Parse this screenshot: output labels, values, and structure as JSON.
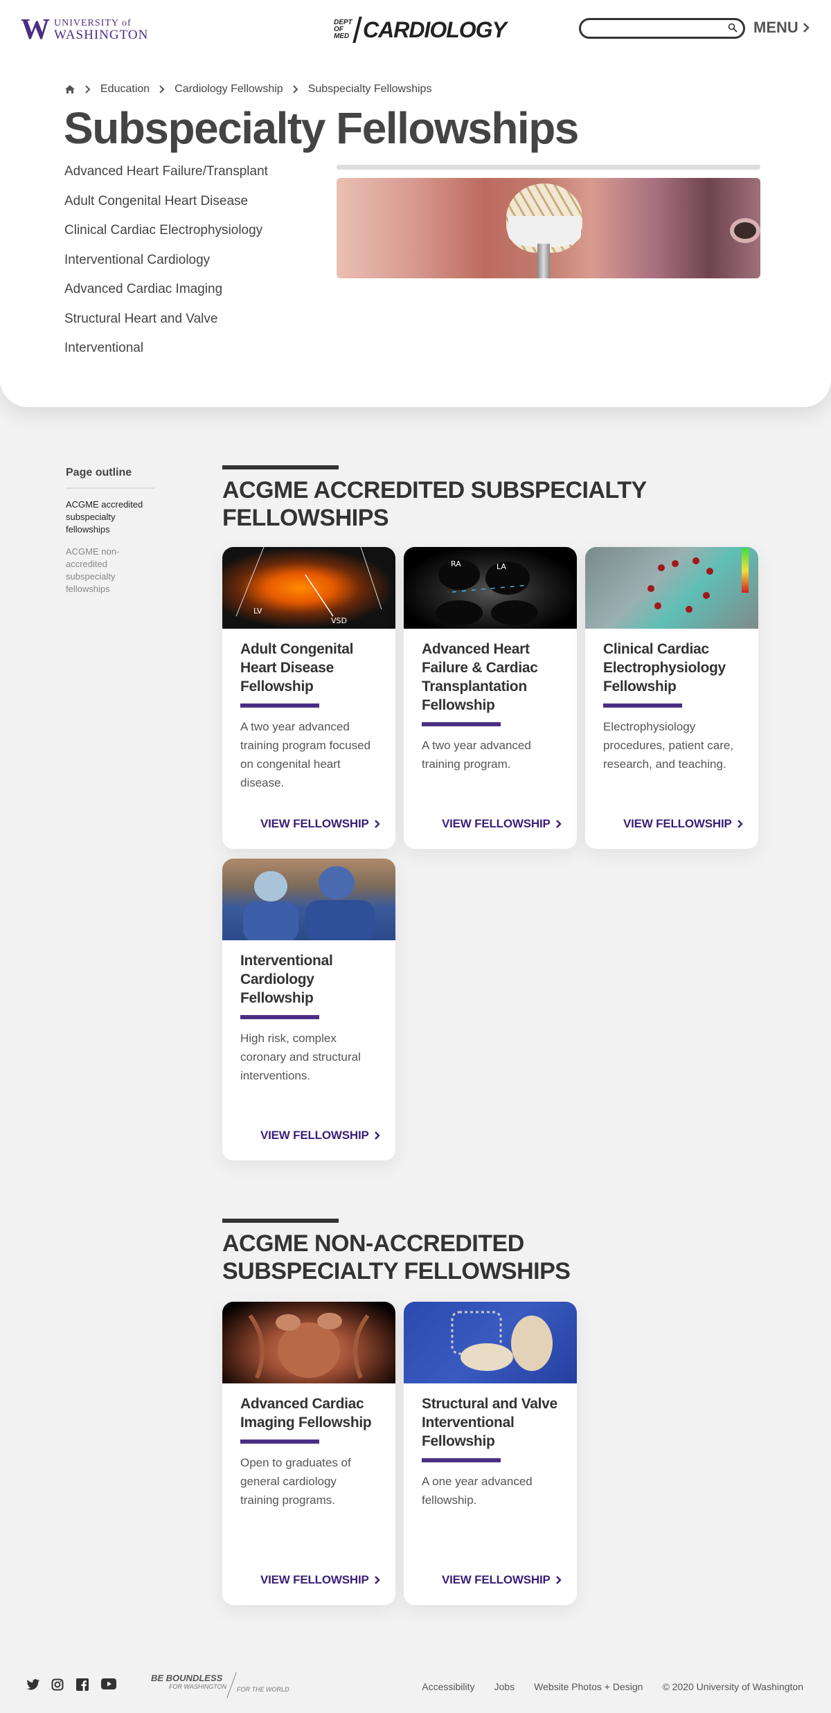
{
  "header": {
    "uw_logo": {
      "mark": "W",
      "line1": "UNIVERSITY of",
      "line2": "WASHINGTON"
    },
    "dept_logo": {
      "line1": "DEPT",
      "line2": "OF",
      "line3": "MED",
      "title": "CARDIOLOGY"
    },
    "search": {
      "placeholder": "",
      "icon": "search-icon"
    },
    "menu_label": "MENU"
  },
  "breadcrumb": {
    "items": [
      "Education",
      "Cardiology Fellowship",
      "Subspecialty Fellowships"
    ]
  },
  "page_title": "Subspecialty Fellowships",
  "subnav": [
    "Advanced Heart Failure/Transplant",
    "Adult Congenital Heart Disease",
    "Clinical Cardiac Electrophysiology",
    "Interventional Cardiology",
    "Advanced Cardiac Imaging",
    "Structural Heart and Valve",
    "Interventional"
  ],
  "outline": {
    "title": "Page outline",
    "items": [
      "ACGME accredited subspecialty fellowships",
      "ACGME non-accredited subspecialty fellowships"
    ]
  },
  "sections": [
    {
      "title": "ACGME ACCREDITED SUBSPECIALTY FELLOWSHIPS",
      "cards": [
        {
          "title": "Adult Congenital Heart Disease Fellowship",
          "desc": "A two year advanced training program focused on congenital heart disease.",
          "cta": "VIEW FELLOWSHIP",
          "img_labels": [
            "LV",
            "VSD"
          ]
        },
        {
          "title": "Advanced Heart Failure & Cardiac Transplantation Fellowship",
          "desc": "A two year advanced training program.",
          "cta": "VIEW FELLOWSHIP",
          "img_labels": [
            "RA",
            "LA"
          ]
        },
        {
          "title": "Clinical Cardiac Electrophysiology Fellowship",
          "desc": "Electrophysiology procedures, patient care, research, and teaching.",
          "cta": "VIEW FELLOWSHIP"
        },
        {
          "title": "Interventional Cardiology Fellowship",
          "desc": "High risk, complex coronary and structural interventions.",
          "cta": "VIEW FELLOWSHIP"
        }
      ]
    },
    {
      "title": "ACGME NON-ACCREDITED SUBSPECIALTY FELLOWSHIPS",
      "cards": [
        {
          "title": "Advanced Cardiac Imaging Fellowship",
          "desc": "Open to graduates of general cardiology training programs.",
          "cta": "VIEW FELLOWSHIP"
        },
        {
          "title": "Structural and Valve Interventional Fellowship",
          "desc": "A one year advanced fellowship.",
          "cta": "VIEW FELLOWSHIP"
        }
      ]
    }
  ],
  "footer": {
    "social": [
      "twitter-icon",
      "instagram-icon",
      "facebook-icon",
      "youtube-icon"
    ],
    "boundless": {
      "line1": "BE BOUNDLESS",
      "line2": "FOR WASHINGTON",
      "line3": "FOR THE WORLD"
    },
    "links": [
      "Accessibility",
      "Jobs",
      "Website Photos + Design",
      "© 2020 University of Washington"
    ]
  },
  "colors": {
    "brand_purple": "#4b2e83",
    "cta_purple": "#3b1f78",
    "text_dark": "#333333"
  }
}
